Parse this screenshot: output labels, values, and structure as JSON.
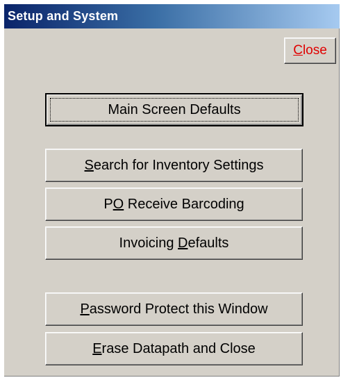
{
  "window": {
    "title": "Setup and System"
  },
  "buttons": {
    "close": {
      "pre": "",
      "key": "C",
      "post": "lose"
    },
    "main_screen": {
      "pre": "Main Screen Defaults",
      "key": "",
      "post": ""
    },
    "search_inventory": {
      "pre": "",
      "key": "S",
      "post": "earch for Inventory Settings"
    },
    "po_receive": {
      "pre": "P",
      "key": "O",
      "post": " Receive Barcoding"
    },
    "invoicing": {
      "pre": "Invoicing ",
      "key": "D",
      "post": "efaults"
    },
    "password": {
      "pre": "",
      "key": "P",
      "post": "assword Protect this Window"
    },
    "erase": {
      "pre": "",
      "key": "E",
      "post": "rase Datapath and Close"
    }
  },
  "colors": {
    "face": "#d4d0c8",
    "title_start": "#0a246a",
    "title_end": "#a6caf0",
    "close_text": "#e00000"
  }
}
